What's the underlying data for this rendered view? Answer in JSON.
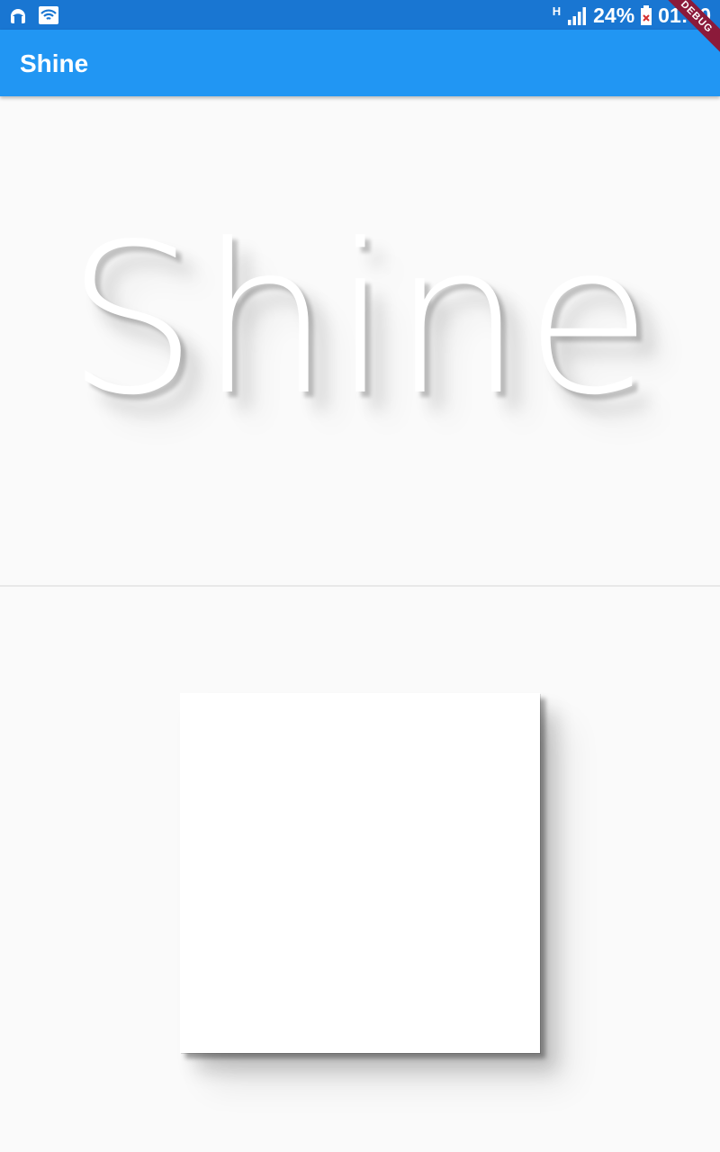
{
  "status_bar": {
    "left_icons": [
      "headphones-icon",
      "wifi-icon"
    ],
    "network_label": "H",
    "battery_percent": "24%",
    "time": "01:30"
  },
  "debug_banner": "DEBUG",
  "app_bar": {
    "title": "Shine"
  },
  "shine_text": {
    "text": "Shine"
  },
  "colors": {
    "status_bar": "#1976d2",
    "app_bar": "#2196f3",
    "background": "#fafafa",
    "text": "#ffffff",
    "debug_banner": "#8b1a3a"
  }
}
